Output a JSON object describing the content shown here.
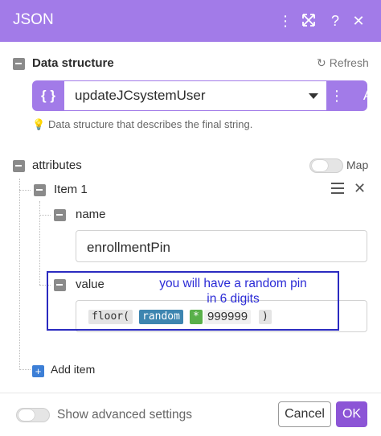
{
  "header": {
    "title": "JSON",
    "icons": [
      "more-vertical-icon",
      "expand-icon",
      "help-icon",
      "close-icon"
    ],
    "accent": "#a27be8"
  },
  "data_structure": {
    "label": "Data structure",
    "refresh_label": "Refresh",
    "brace": "{ }",
    "selected": "updateJCsystemUser",
    "add_label": "Add",
    "hint": "Data structure that describes the final string."
  },
  "attributes": {
    "label": "attributes",
    "map_label": "Map",
    "item": {
      "label": "Item 1",
      "name_label": "name",
      "name_value": "enrollmentPin",
      "value_label": "value",
      "formula": {
        "func_open": "floor(",
        "fn": "random",
        "op": "*",
        "number": "999999",
        "close": ")"
      }
    },
    "add_item_label": "Add item"
  },
  "annotation": {
    "line1": "you will have a random pin",
    "line2": "in 6 digits",
    "color": "#2b2bd6"
  },
  "footer": {
    "advanced_label": "Show advanced settings",
    "cancel_label": "Cancel",
    "ok_label": "OK",
    "ok_color": "#8c55d6"
  }
}
